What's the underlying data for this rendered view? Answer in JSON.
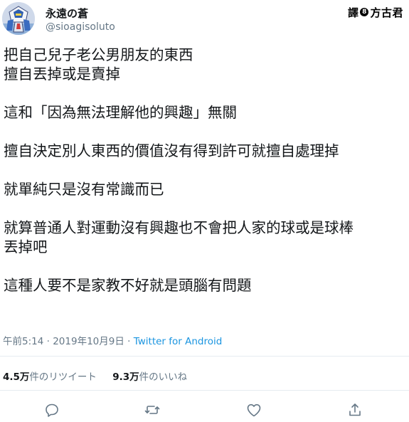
{
  "author": {
    "display_name": "永遠の蒼",
    "handle": "@sioagisoluto",
    "avatar_icon": "avatar-robot-icon"
  },
  "translator_badge": {
    "prefix": "譯",
    "separator": "8",
    "name": "方古君"
  },
  "tweet": {
    "lines": [
      "把自己兒子老公男朋友的東西",
      "擅自丟掉或是賣掉",
      "",
      "這和「因為無法理解他的興趣」無關",
      "",
      "擅自決定別人東西的價值沒有得到許可就擅自處理掉",
      "",
      "就單純只是沒有常識而已",
      "",
      "就算普通人對運動沒有興趣也不會把人家的球或是球棒",
      "丟掉吧",
      "",
      "這種人要不是家教不好就是頭腦有問題"
    ]
  },
  "meta": {
    "time": "午前5:14",
    "date": "2019年10月9日",
    "separator": "·",
    "source": "Twitter for Android"
  },
  "stats": {
    "retweets_count": "4.5万",
    "retweets_label": "件のリツイート",
    "likes_count": "9.3万",
    "likes_label": "件のいいね"
  },
  "actions": {
    "reply_icon": "reply-icon",
    "retweet_icon": "retweet-icon",
    "like_icon": "like-icon",
    "share_icon": "share-icon"
  },
  "colors": {
    "text": "#14171a",
    "secondary": "#657786",
    "link": "#1b95e0",
    "divider": "#e6ecf0"
  }
}
